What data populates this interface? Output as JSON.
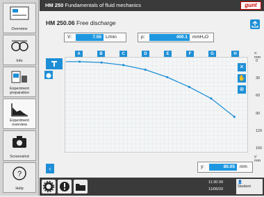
{
  "sidebar": {
    "items": [
      {
        "label": "Overview",
        "icon": "overview-icon"
      },
      {
        "label": "Info",
        "icon": "glasses-icon"
      },
      {
        "label": "Experiment preparation",
        "icon": "experiment-preparation-icon"
      },
      {
        "label": "Experiment overview",
        "icon": "chart-icon"
      },
      {
        "label": "Screenshot",
        "icon": "camera-icon"
      },
      {
        "label": "Help",
        "icon": "help-icon"
      }
    ]
  },
  "topbar": {
    "code": "HM 250",
    "title": "Fundamentals of fluid mechanics",
    "logo": "gunt"
  },
  "page": {
    "code": "HM 250.06",
    "title": "Free discharge"
  },
  "readouts": {
    "flow": {
      "label": "V̇:",
      "value": "7.55",
      "unit": "L/min"
    },
    "pressure": {
      "label": "p:",
      "value": "400.1",
      "unit": "mmH₂O"
    },
    "y": {
      "label": "y:",
      "value": "80.05",
      "unit": "mm"
    }
  },
  "columns": [
    "A",
    "B",
    "C",
    "D",
    "E",
    "F",
    "G",
    "H"
  ],
  "axis": {
    "x_label": "x: mm",
    "y_label": "y: mm",
    "y_ticks": [
      "0",
      "30",
      "60",
      "90",
      "120",
      "150"
    ]
  },
  "chart_data": {
    "type": "line",
    "series": [
      {
        "values": [
          0,
          1.5,
          6,
          14,
          27,
          44,
          64,
          96
        ]
      }
    ],
    "categories": [
      "A",
      "B",
      "C",
      "D",
      "E",
      "F",
      "G",
      "H"
    ],
    "ylim": [
      0,
      150
    ],
    "color": "#1e8fd6"
  },
  "status": {
    "time": "11:30:39",
    "date": "11/06/20",
    "user": "Student"
  }
}
